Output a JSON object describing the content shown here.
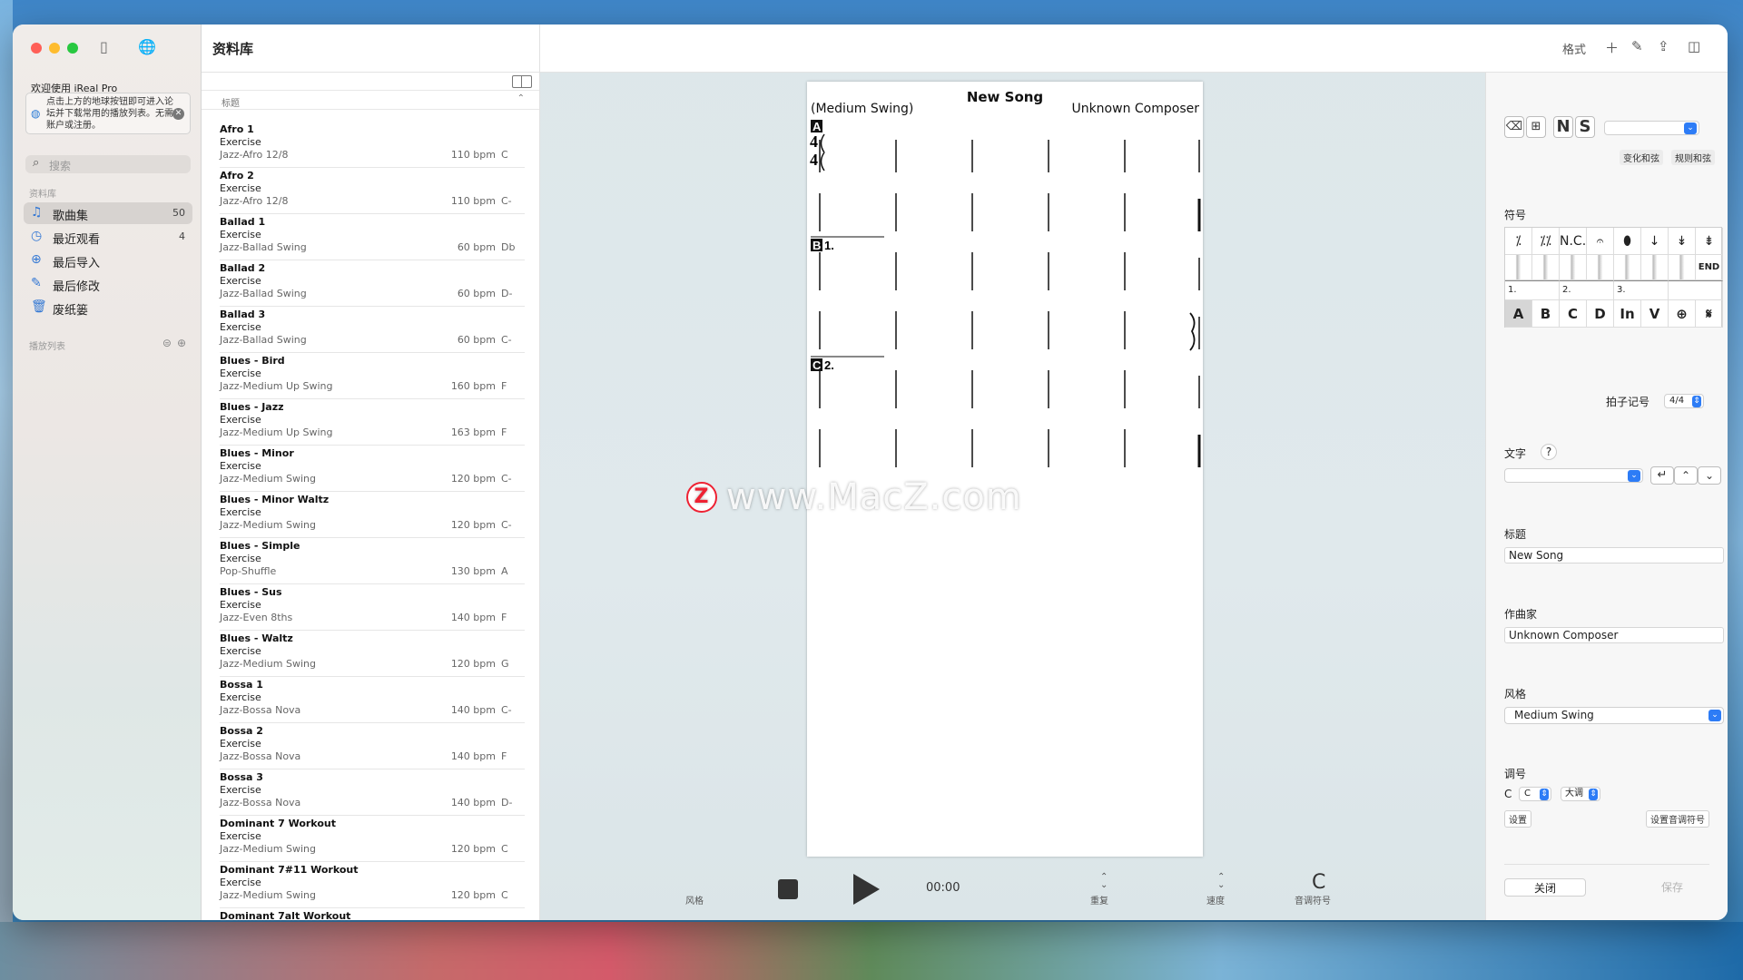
{
  "sidebar": {
    "welcome_title": "欢迎使用 iReal Pro",
    "welcome_text": "点击上方的地球按钮即可进入论坛并下载常用的播放列表。无需账户或注册。",
    "search_placeholder": "搜索",
    "library_section": "资料库",
    "items": [
      {
        "label": "歌曲集",
        "count": "50"
      },
      {
        "label": "最近观看",
        "count": "4"
      },
      {
        "label": "最后导入",
        "count": ""
      },
      {
        "label": "最后修改",
        "count": ""
      },
      {
        "label": "废纸篓",
        "count": ""
      }
    ],
    "playlist_section": "播放列表"
  },
  "library": {
    "title": "资料库",
    "column_title": "标题",
    "songs": [
      {
        "name": "Afro 1",
        "type": "Exercise",
        "style": "Jazz-Afro 12/8",
        "bpm": "110 bpm",
        "key": "C"
      },
      {
        "name": "Afro 2",
        "type": "Exercise",
        "style": "Jazz-Afro 12/8",
        "bpm": "110 bpm",
        "key": "C-"
      },
      {
        "name": "Ballad 1",
        "type": "Exercise",
        "style": "Jazz-Ballad Swing",
        "bpm": "60 bpm",
        "key": "Db"
      },
      {
        "name": "Ballad 2",
        "type": "Exercise",
        "style": "Jazz-Ballad Swing",
        "bpm": "60 bpm",
        "key": "D-"
      },
      {
        "name": "Ballad 3",
        "type": "Exercise",
        "style": "Jazz-Ballad Swing",
        "bpm": "60 bpm",
        "key": "C-"
      },
      {
        "name": "Blues - Bird",
        "type": "Exercise",
        "style": "Jazz-Medium Up Swing",
        "bpm": "160 bpm",
        "key": "F"
      },
      {
        "name": "Blues - Jazz",
        "type": "Exercise",
        "style": "Jazz-Medium Up Swing",
        "bpm": "163 bpm",
        "key": "F"
      },
      {
        "name": "Blues - Minor",
        "type": "Exercise",
        "style": "Jazz-Medium Swing",
        "bpm": "120 bpm",
        "key": "C-"
      },
      {
        "name": "Blues - Minor Waltz",
        "type": "Exercise",
        "style": "Jazz-Medium Swing",
        "bpm": "120 bpm",
        "key": "C-"
      },
      {
        "name": "Blues - Simple",
        "type": "Exercise",
        "style": "Pop-Shuffle",
        "bpm": "130 bpm",
        "key": "A"
      },
      {
        "name": "Blues - Sus",
        "type": "Exercise",
        "style": "Jazz-Even 8ths",
        "bpm": "140 bpm",
        "key": "F"
      },
      {
        "name": "Blues - Waltz",
        "type": "Exercise",
        "style": "Jazz-Medium Swing",
        "bpm": "120 bpm",
        "key": "G"
      },
      {
        "name": "Bossa 1",
        "type": "Exercise",
        "style": "Jazz-Bossa Nova",
        "bpm": "140 bpm",
        "key": "C-"
      },
      {
        "name": "Bossa 2",
        "type": "Exercise",
        "style": "Jazz-Bossa Nova",
        "bpm": "140 bpm",
        "key": "F"
      },
      {
        "name": "Bossa 3",
        "type": "Exercise",
        "style": "Jazz-Bossa Nova",
        "bpm": "140 bpm",
        "key": "D-"
      },
      {
        "name": "Dominant 7 Workout",
        "type": "Exercise",
        "style": "Jazz-Medium Swing",
        "bpm": "120 bpm",
        "key": "C"
      },
      {
        "name": "Dominant 7#11 Workout",
        "type": "Exercise",
        "style": "Jazz-Medium Swing",
        "bpm": "120 bpm",
        "key": "C"
      },
      {
        "name": "Dominant 7alt Workout",
        "type": "",
        "style": "",
        "bpm": "",
        "key": ""
      }
    ]
  },
  "sheet": {
    "title": "New Song",
    "style": "(Medium Swing)",
    "composer": "Unknown Composer",
    "section_a": "A",
    "section_b": "B",
    "section_c": "C",
    "ending_1": "1.",
    "ending_2": "2.",
    "time_top": "4",
    "time_bottom": "4"
  },
  "watermark": {
    "z": "Z",
    "text": "www.MacZ.com"
  },
  "transport": {
    "style_label": "风格",
    "time": "00:00",
    "repeat_label": "重复",
    "tempo_label": "速度",
    "key_symbol": "C",
    "key_label": "音调符号"
  },
  "toolbar": {
    "format": "格式"
  },
  "inspector": {
    "n_btn": "N",
    "s_btn": "S",
    "alt_chord": "变化和弦",
    "rule_chord": "规则和弦",
    "symbols_label": "符号",
    "symbols_row1": [
      "⁒",
      "⁒⁒",
      "N.C.",
      "𝄐",
      "⬮",
      "↓",
      "↡",
      "⇟"
    ],
    "symbols_row2": [
      "",
      "",
      "",
      "",
      "",
      "",
      "",
      "END"
    ],
    "endings": [
      "1.",
      "2.",
      "3.",
      ""
    ],
    "sections": [
      "A",
      "B",
      "C",
      "D",
      "In",
      "V",
      "⊕",
      "𝄋"
    ],
    "time_sig_label": "拍子记号",
    "time_sig_value": "4/4",
    "text_label": "文字",
    "help": "?",
    "title_label": "标题",
    "title_value": "New Song",
    "composer_label": "作曲家",
    "composer_value": "Unknown Composer",
    "style_label": "风格",
    "style_value": "Medium Swing",
    "key_label": "调号",
    "key_root": "C",
    "key_select": "C",
    "mode_select": "大调",
    "set_btn": "设置",
    "set_key_btn": "设置音调符号",
    "close_btn": "关闭",
    "save_btn": "保存"
  }
}
